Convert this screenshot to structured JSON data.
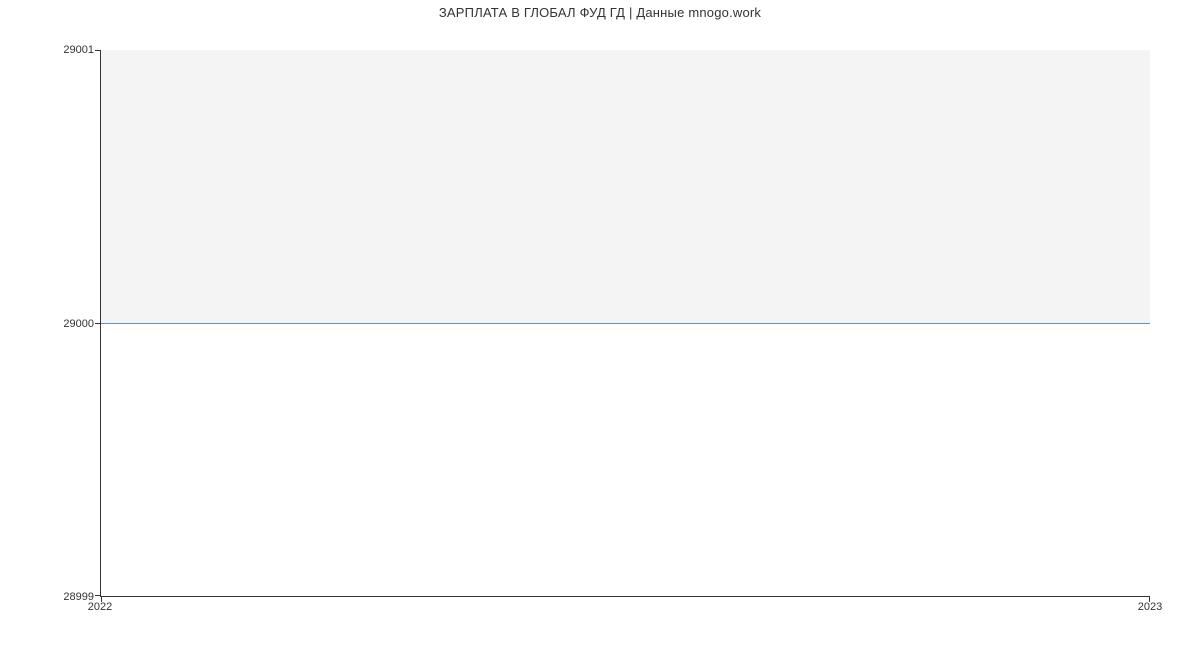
{
  "chart_data": {
    "type": "area",
    "title": "ЗАРПЛАТА В ГЛОБАЛ ФУД ГД | Данные mnogo.work",
    "x": [
      2022,
      2023
    ],
    "y": [
      29000,
      29000
    ],
    "xticks": [
      "2022",
      "2023"
    ],
    "yticks": [
      "28999",
      "29000",
      "29001"
    ],
    "xlim": [
      2022,
      2023
    ],
    "ylim": [
      28999,
      29001
    ],
    "xlabel": "",
    "ylabel": ""
  }
}
